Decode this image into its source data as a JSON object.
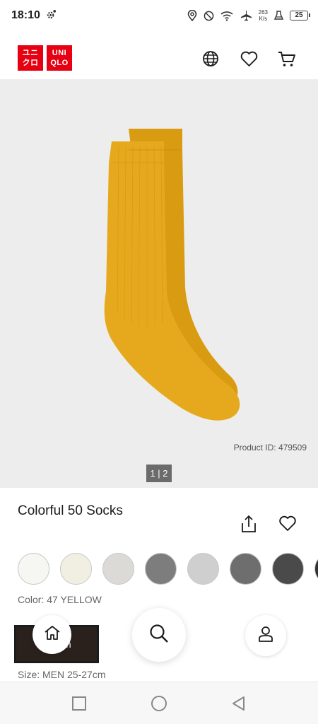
{
  "status_bar": {
    "time": "18:10",
    "net_speed_value": "263",
    "net_speed_unit": "K/s",
    "battery": "25"
  },
  "header": {
    "logo_top_left": "ユニ",
    "logo_bottom_left": "クロ",
    "logo_top_right": "UNI",
    "logo_bottom_right": "QLO",
    "icons": [
      "globe-icon",
      "heart-icon",
      "cart-icon"
    ]
  },
  "product": {
    "product_id": "Product ID: 479509",
    "image_pager": "1 | 2",
    "name": "Colorful 50 Socks",
    "color_label": "Color: 47 YELLOW",
    "size_label": "Size: MEN 25-27cm",
    "size_button_partial": "m"
  },
  "swatches": [
    {
      "name": "off-white",
      "color": "#f6f6f2"
    },
    {
      "name": "natural",
      "color": "#f1efe2"
    },
    {
      "name": "light-gray",
      "color": "#dcdad6"
    },
    {
      "name": "gray",
      "color": "#7d7d7d"
    },
    {
      "name": "light-gray-2",
      "color": "#cfcfcf"
    },
    {
      "name": "heather-gray",
      "color": "#6e6e6e"
    },
    {
      "name": "dark-gray",
      "color": "#4a4a4a"
    },
    {
      "name": "charcoal",
      "color": "#333333"
    }
  ],
  "colors": {
    "brand": "#e60012",
    "sock": "#e5a81c"
  }
}
